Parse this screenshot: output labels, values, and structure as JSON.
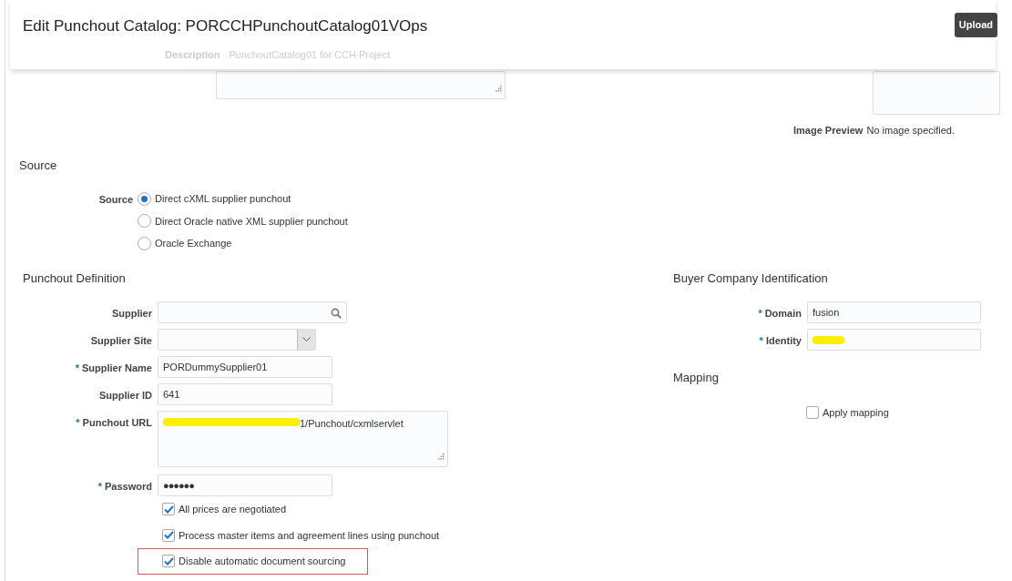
{
  "header": {
    "title": "Edit Punchout Catalog: PORCCHPunchoutCatalog01VOps",
    "upload_button": "Upload",
    "description_label": "Description",
    "description_value": "PunchoutCatalog01 for CCH Project"
  },
  "image_preview": {
    "label": "Image Preview",
    "value": "No image specified."
  },
  "source": {
    "heading": "Source",
    "label": "Source",
    "options": [
      {
        "label": "Direct cXML supplier punchout",
        "selected": true
      },
      {
        "label": "Direct Oracle native XML supplier punchout",
        "selected": false
      },
      {
        "label": "Oracle Exchange",
        "selected": false
      }
    ]
  },
  "punchout_definition": {
    "heading": "Punchout Definition",
    "fields": [
      {
        "kind": "search",
        "label": "Supplier"
      },
      {
        "kind": "select",
        "label": "Supplier Site"
      },
      {
        "kind": "text",
        "label": "Supplier Name",
        "required_mark": "*",
        "value": "PORDummySupplier01"
      },
      {
        "kind": "text",
        "label": "Supplier ID",
        "value": "641"
      },
      {
        "kind": "textarea",
        "label": "Punchout URL",
        "required_mark": "*",
        "value": "1/Punchout/cxmlservlet",
        "redacted": true
      },
      {
        "kind": "password",
        "label": "Password",
        "required_mark": "*",
        "value": "●●●●●●"
      }
    ],
    "checkboxes": [
      {
        "label": "All prices are negotiated",
        "checked": true,
        "highlighted": false
      },
      {
        "label": "Process master items and agreement lines using punchout",
        "checked": true,
        "highlighted": false
      },
      {
        "label": "Disable automatic document sourcing",
        "checked": true,
        "highlighted": true
      }
    ]
  },
  "buyer_company_identification": {
    "heading": "Buyer Company Identification",
    "fields": [
      {
        "label": "Domain",
        "required_mark": "*",
        "value": "fusion"
      },
      {
        "label": "Identity",
        "required_mark": "*",
        "redacted": true
      }
    ]
  },
  "mapping": {
    "heading": "Mapping",
    "checkbox": {
      "label": "Apply mapping",
      "checked": false
    }
  }
}
